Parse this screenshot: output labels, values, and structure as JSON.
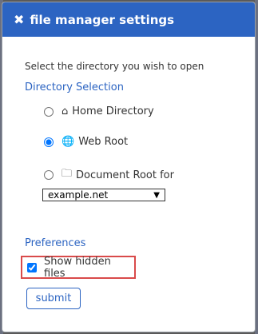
{
  "dialog": {
    "title": "file manager settings",
    "prompt": "Select the directory you wish to open"
  },
  "directory_selection": {
    "title": "Directory Selection",
    "options": [
      {
        "label": "Home Directory",
        "icon": "home-icon",
        "selected": false
      },
      {
        "label": "Web Root",
        "icon": "globe-icon",
        "selected": true
      },
      {
        "label": "Document Root for",
        "icon": "folder-icon",
        "selected": false
      }
    ],
    "domain_select_value": "example.net"
  },
  "preferences": {
    "title": "Preferences",
    "show_hidden_files_label": "Show hidden files",
    "show_hidden_files_checked": true
  },
  "buttons": {
    "submit_label": "submit"
  },
  "colors": {
    "accent": "#2c64c2",
    "highlight_border": "#d94a4a"
  }
}
